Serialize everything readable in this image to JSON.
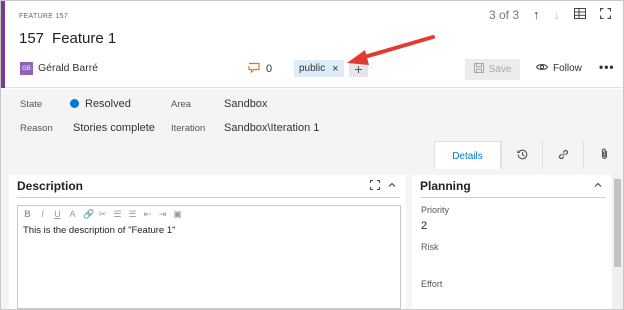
{
  "header": {
    "type_label": "FEATURE 157",
    "id": "157",
    "title": "Feature 1",
    "position": "3 of 3",
    "author_initials": "GB",
    "author": "Gérald Barré",
    "comment_count": "0",
    "tag": "public",
    "tag_remove_glyph": "×",
    "tag_add_glyph": "+",
    "save_label": "Save",
    "follow_label": "Follow",
    "more_glyph": "•••",
    "up_glyph": "↑",
    "down_glyph": "↓",
    "fullscreen_glyph": "⛶"
  },
  "fields": {
    "state_label": "State",
    "state_value": "Resolved",
    "reason_label": "Reason",
    "reason_value": "Stories complete",
    "area_label": "Area",
    "area_value": "Sandbox",
    "iteration_label": "Iteration",
    "iteration_value": "Sandbox\\Iteration 1"
  },
  "tabs": [
    {
      "label": "Details",
      "icon": "details",
      "active": true
    },
    {
      "label": "",
      "icon": "history-icon"
    },
    {
      "label": "",
      "icon": "link-icon"
    },
    {
      "label": "",
      "icon": "attachment-icon"
    }
  ],
  "description": {
    "title": "Description",
    "text": "This is the description of \"Feature 1\"",
    "toolbar": [
      "B",
      "I",
      "U",
      "A",
      "🔗",
      "✂",
      "☰",
      "☰",
      "⇤",
      "⇥",
      "▣"
    ]
  },
  "planning": {
    "title": "Planning",
    "priority_label": "Priority",
    "priority_value": "2",
    "risk_label": "Risk",
    "effort_label": "Effort"
  },
  "colors": {
    "accent": "#773b93",
    "state_dot": "#0078d4",
    "tag_bg": "#dcecf9",
    "arrow": "#e03c31"
  }
}
